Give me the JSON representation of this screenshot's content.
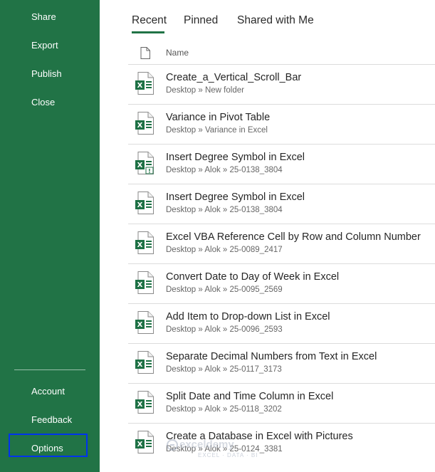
{
  "sidebar": {
    "items": [
      {
        "label": "Share"
      },
      {
        "label": "Export"
      },
      {
        "label": "Publish"
      },
      {
        "label": "Close"
      }
    ],
    "bottom_items": [
      {
        "label": "Account"
      },
      {
        "label": "Feedback"
      },
      {
        "label": "Options"
      }
    ],
    "background": "#217346",
    "highlight_color": "#0033ee"
  },
  "tabs": [
    {
      "label": "Recent",
      "active": true
    },
    {
      "label": "Pinned",
      "active": false
    },
    {
      "label": "Shared with Me",
      "active": false
    }
  ],
  "list": {
    "column_name": "Name",
    "files": [
      {
        "title": "Create_a_Vertical_Scroll_Bar",
        "path": "Desktop » New folder",
        "icon": "excel-file-icon"
      },
      {
        "title": "Variance in Pivot Table",
        "path": "Desktop » Variance in Excel",
        "icon": "excel-file-icon"
      },
      {
        "title": "Insert Degree Symbol in Excel",
        "path": "Desktop » Alok » 25-0138_3804",
        "icon": "excel-macro-file-icon"
      },
      {
        "title": "Insert Degree Symbol in Excel",
        "path": "Desktop » Alok » 25-0138_3804",
        "icon": "excel-file-icon"
      },
      {
        "title": "Excel VBA Reference Cell by Row and Column Number",
        "path": "Desktop » Alok » 25-0089_2417",
        "icon": "excel-file-icon"
      },
      {
        "title": "Convert Date to Day of Week in Excel",
        "path": "Desktop » Alok » 25-0095_2569",
        "icon": "excel-file-icon"
      },
      {
        "title": "Add Item to Drop-down List in Excel",
        "path": "Desktop » Alok » 25-0096_2593",
        "icon": "excel-file-icon"
      },
      {
        "title": "Separate Decimal Numbers from Text in Excel",
        "path": "Desktop » Alok » 25-0117_3173",
        "icon": "excel-file-icon"
      },
      {
        "title": "Split Date and Time Column in Excel",
        "path": "Desktop » Alok » 25-0118_3202",
        "icon": "excel-file-icon"
      },
      {
        "title": "Create a Database in Excel with Pictures",
        "path": "Desktop » Alok » 25-0124_3381",
        "icon": "excel-file-icon"
      }
    ]
  },
  "watermark": {
    "brand": "exceldemy",
    "tagline": "EXCEL · DATA · BI"
  }
}
